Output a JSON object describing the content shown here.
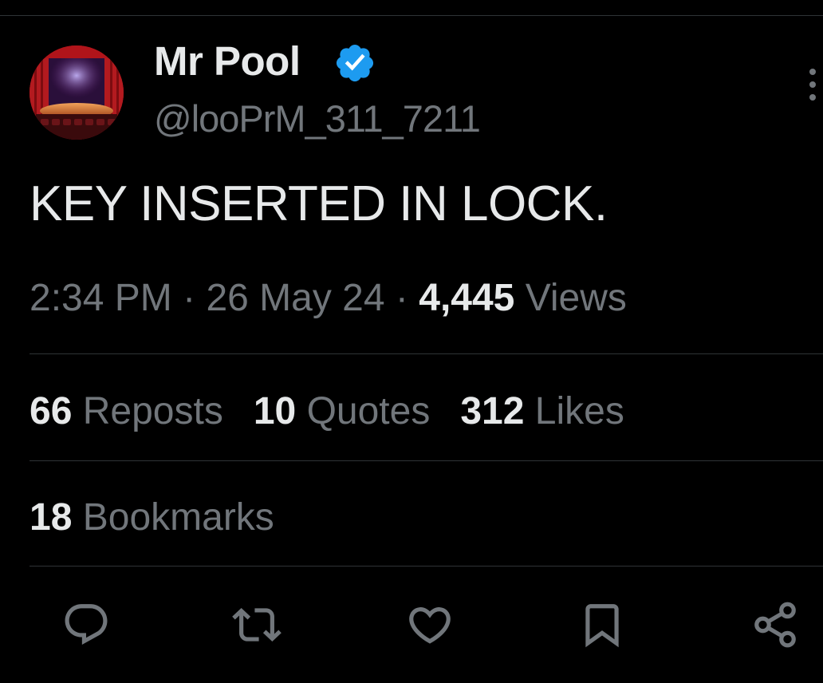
{
  "author": {
    "display_name": "Mr Pool",
    "handle": "@looPrM_311_7211",
    "verified_icon": "verified-badge-icon",
    "avatar": "theater-stage-avatar"
  },
  "tweet": {
    "text": "KEY INSERTED IN LOCK.",
    "time": "2:34 PM",
    "separator": "·",
    "date": "26 May 24",
    "views_count": "4,445",
    "views_label": "Views"
  },
  "stats": {
    "reposts": {
      "count": "66",
      "label": "Reposts"
    },
    "quotes": {
      "count": "10",
      "label": "Quotes"
    },
    "likes": {
      "count": "312",
      "label": "Likes"
    },
    "bookmarks": {
      "count": "18",
      "label": "Bookmarks"
    }
  },
  "actions": [
    "reply-icon",
    "repost-icon",
    "like-icon",
    "bookmark-icon",
    "share-icon"
  ],
  "colors": {
    "background": "#000000",
    "text_primary": "#e7e9ea",
    "text_secondary": "#71767b",
    "divider": "#2f3336",
    "verified_blue": "#1d9bf0"
  }
}
